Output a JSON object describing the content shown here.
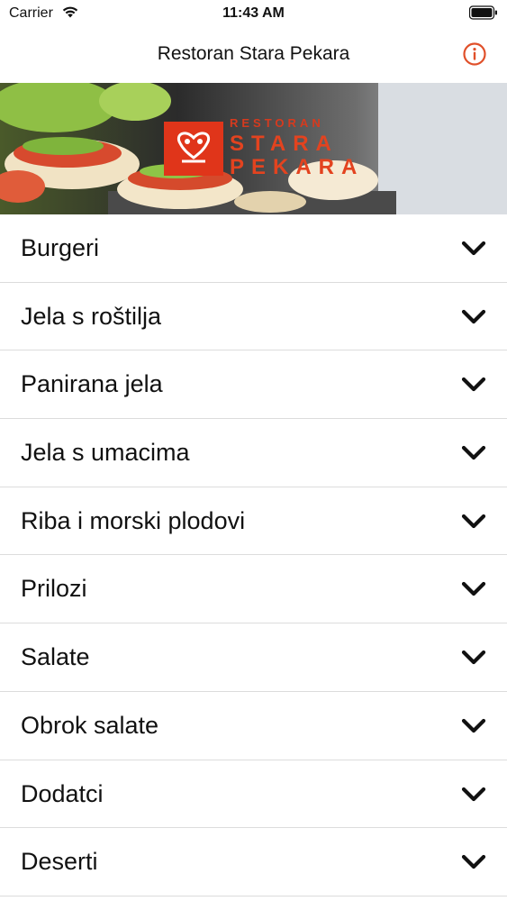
{
  "status_bar": {
    "carrier": "Carrier",
    "time": "11:43 AM"
  },
  "nav": {
    "title": "Restoran Stara Pekara",
    "info_icon": "info-circle-icon",
    "accent_color": "#e0502a"
  },
  "hero": {
    "logo_small": "RESTORAN",
    "logo_line1": "STARA",
    "logo_line2": "PEKARA"
  },
  "menu": {
    "items": [
      {
        "label": "Burgeri"
      },
      {
        "label": "Jela s roštilja"
      },
      {
        "label": "Panirana jela"
      },
      {
        "label": "Jela s umacima"
      },
      {
        "label": "Riba i morski plodovi"
      },
      {
        "label": "Prilozi"
      },
      {
        "label": "Salate"
      },
      {
        "label": "Obrok salate"
      },
      {
        "label": "Dodatci"
      },
      {
        "label": "Deserti"
      }
    ],
    "chevron_icon": "chevron-down-icon"
  }
}
